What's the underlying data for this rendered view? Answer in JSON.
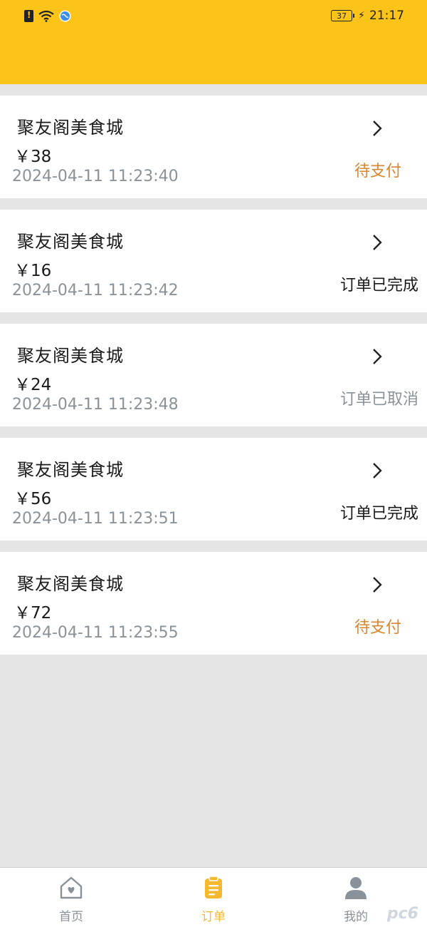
{
  "status_bar": {
    "battery_level": "37",
    "time": "21:17",
    "icons": [
      "sim-alert-icon",
      "wifi-icon",
      "globe-icon",
      "battery-icon",
      "charging-icon"
    ]
  },
  "orders": [
    {
      "shop": "聚友阁美食城",
      "price": "￥38",
      "time": "2024-04-11 11:23:40",
      "status": "待支付",
      "status_type": "pending"
    },
    {
      "shop": "聚友阁美食城",
      "price": "￥16",
      "time": "2024-04-11 11:23:42",
      "status": "订单已完成",
      "status_type": "done"
    },
    {
      "shop": "聚友阁美食城",
      "price": "￥24",
      "time": "2024-04-11 11:23:48",
      "status": "订单已取消",
      "status_type": "cancel"
    },
    {
      "shop": "聚友阁美食城",
      "price": "￥56",
      "time": "2024-04-11 11:23:51",
      "status": "订单已完成",
      "status_type": "done"
    },
    {
      "shop": "聚友阁美食城",
      "price": "￥72",
      "time": "2024-04-11 11:23:55",
      "status": "待支付",
      "status_type": "pending"
    }
  ],
  "tabbar": {
    "tabs": [
      {
        "label": "首页",
        "icon": "home-icon",
        "active": false
      },
      {
        "label": "订单",
        "icon": "clipboard-icon",
        "active": true
      },
      {
        "label": "我的",
        "icon": "user-icon",
        "active": false
      }
    ]
  },
  "watermark": "pc6",
  "colors": {
    "header": "#fcc419",
    "pending": "#d9862d",
    "active_tab": "#f5b82e",
    "muted": "#8a9299",
    "background": "#e5e5e5"
  }
}
